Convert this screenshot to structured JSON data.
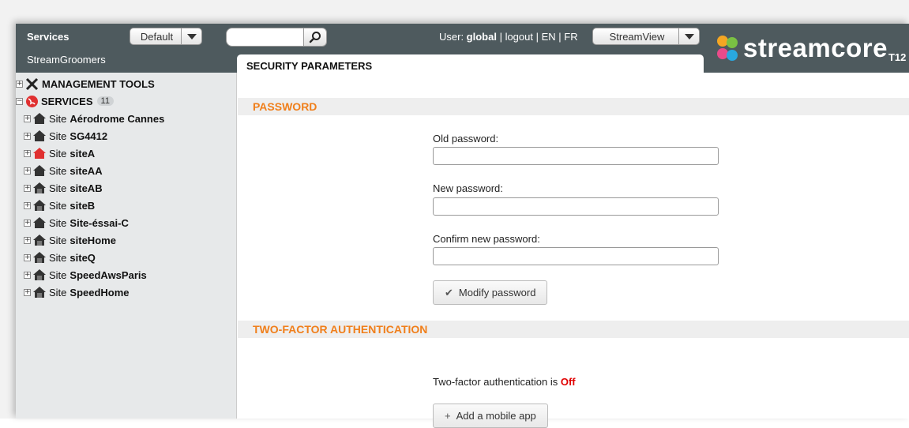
{
  "topbar": {
    "services_label": "Services",
    "groomers_label": "StreamGroomers",
    "default_select": "Default",
    "search_placeholder": "",
    "user_prefix": "User: ",
    "user_name": "global",
    "logout": "logout",
    "lang_en": "EN",
    "lang_fr": "FR",
    "sep": " | ",
    "view_select": "StreamView",
    "logo_text": "streamcore",
    "logo_suffix": "T12"
  },
  "tab": {
    "title": "SECURITY PARAMETERS"
  },
  "sidebar": {
    "management": "MANAGEMENT TOOLS",
    "services": "SERVICES",
    "services_count": "11",
    "site_prefix": "Site",
    "sites": [
      {
        "name": "Aérodrome Cannes",
        "icon": "house-dark-icon"
      },
      {
        "name": "SG4412",
        "icon": "house-dark-icon"
      },
      {
        "name": "siteA",
        "icon": "house-red-icon"
      },
      {
        "name": "siteAA",
        "icon": "house-dark-icon"
      },
      {
        "name": "siteAB",
        "icon": "house-garage-icon"
      },
      {
        "name": "siteB",
        "icon": "house-garage-icon"
      },
      {
        "name": "Site-éssai-C",
        "icon": "house-dark-icon"
      },
      {
        "name": "siteHome",
        "icon": "house-garage-icon"
      },
      {
        "name": "siteQ",
        "icon": "house-garage-icon"
      },
      {
        "name": "SpeedAwsParis",
        "icon": "house-garage-icon"
      },
      {
        "name": "SpeedHome",
        "icon": "house-garage-icon"
      }
    ]
  },
  "password": {
    "section_title": "PASSWORD",
    "old_label": "Old password:",
    "new_label": "New password:",
    "confirm_label": "Confirm new password:",
    "old_value": "",
    "new_value": "",
    "confirm_value": "",
    "modify_button": "Modify password"
  },
  "tfa": {
    "section_title": "TWO-FACTOR AUTHENTICATION",
    "status_prefix": "Two-factor authentication is ",
    "status_value": "Off",
    "add_button": "Add a mobile app"
  },
  "colors": {
    "topbar": "#4e5a5e",
    "section_title": "#f07f1b",
    "status_off": "#e00000",
    "site_red": "#e03030"
  }
}
